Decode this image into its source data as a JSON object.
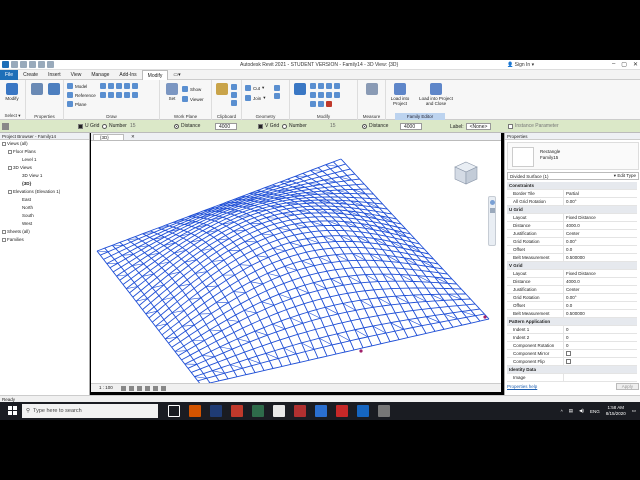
{
  "title_bar": {
    "title": "Autodesk Revit 2021 - STUDENT VERSION - Family14 - 3D View: {3D}",
    "sign_in": "Sign In"
  },
  "menu_tabs": [
    "File",
    "Create",
    "Insert",
    "View",
    "Manage",
    "Add-Ins",
    "Modify"
  ],
  "ribbon": {
    "select": {
      "modify": "Modify",
      "select": "Select ▾"
    },
    "properties": {
      "label": "Properties"
    },
    "draw": {
      "model": "Model",
      "reference": "Reference",
      "plane": "Plane",
      "label": "Draw"
    },
    "work_plane": {
      "set": "Set",
      "show": "Show",
      "viewer": "Viewer",
      "label": "Work Plane"
    },
    "clipboard": {
      "label": "Clipboard"
    },
    "geometry": {
      "cut": "Cut",
      "join": "Join",
      "label": "Geometry"
    },
    "modify": {
      "label": "Modify"
    },
    "measure": {
      "label": "Measure"
    },
    "family_editor": {
      "load_into_project": "Load into Project",
      "load_close": "Load into Project and Close",
      "label": "Family Editor"
    }
  },
  "options_bar": {
    "u_grid": "U Grid",
    "number": "Number",
    "distance": "Distance",
    "u_number_value": "15",
    "u_distance_value": "4000",
    "v_grid": "V Grid",
    "v_number": "Number",
    "v_distance": "Distance",
    "v_number_value": "15",
    "v_distance_value": "4000",
    "label": "Label:",
    "label_value": "<None>",
    "instance_parameter": "Instance Parameter"
  },
  "project_browser": {
    "header": "Project Browser - Family14",
    "items": [
      "Views (all)",
      "Floor Plans",
      "Level 1",
      "3D Views",
      "3D View 1",
      "{3D}",
      "Elevations (Elevation 1)",
      "East",
      "North",
      "South",
      "West",
      "Sheets (all)",
      "Families"
    ]
  },
  "view": {
    "tab_label": "{3D}",
    "scale": "1 : 100",
    "surface_color": "#1f4fd6"
  },
  "properties": {
    "header": "Properties",
    "type_name": "Rectangle",
    "type_family": "Family15",
    "selector": "Divided Surface (1)",
    "edit_type": "Edit Type",
    "rows": [
      {
        "section": "Constraints"
      },
      {
        "k": "Border Tile",
        "v": "Partial"
      },
      {
        "k": "All Grid Rotation",
        "v": "0.00°"
      },
      {
        "section": "U Grid"
      },
      {
        "k": "Layout",
        "v": "Fixed Distance"
      },
      {
        "k": "Distance",
        "v": "4000.0"
      },
      {
        "k": "Justification",
        "v": "Center"
      },
      {
        "k": "Grid Rotation",
        "v": "0.00°"
      },
      {
        "k": "Offset",
        "v": "0.0"
      },
      {
        "k": "Belt Measurement",
        "v": "0.500000"
      },
      {
        "section": "V Grid"
      },
      {
        "k": "Layout",
        "v": "Fixed Distance"
      },
      {
        "k": "Distance",
        "v": "4000.0"
      },
      {
        "k": "Justification",
        "v": "Center"
      },
      {
        "k": "Grid Rotation",
        "v": "0.00°"
      },
      {
        "k": "Offset",
        "v": "0.0"
      },
      {
        "k": "Belt Measurement",
        "v": "0.500000"
      },
      {
        "section": "Pattern Application"
      },
      {
        "k": "Indent 1",
        "v": "0"
      },
      {
        "k": "Indent 2",
        "v": "0"
      },
      {
        "k": "Component Rotation",
        "v": "0"
      },
      {
        "k": "Component Mirror",
        "v": "",
        "check": true
      },
      {
        "k": "Component Flip",
        "v": "",
        "check": true
      },
      {
        "section": "Identity Data"
      },
      {
        "k": "Image",
        "v": ""
      }
    ],
    "help_link": "Properties help",
    "apply": "Apply"
  },
  "status": {
    "text": "Ready"
  },
  "taskbar": {
    "search_placeholder": "Type here to search",
    "language": "ENG",
    "time": "1:58 AM",
    "date": "8/15/2020",
    "app_colors": [
      "#ffffff",
      "#d35400",
      "#1f3b73",
      "#c0392b",
      "#2e6b4a",
      "#e8e8e8",
      "#b03030",
      "#2a6fd0",
      "#c62828",
      "#1565c0",
      "#777777"
    ]
  }
}
